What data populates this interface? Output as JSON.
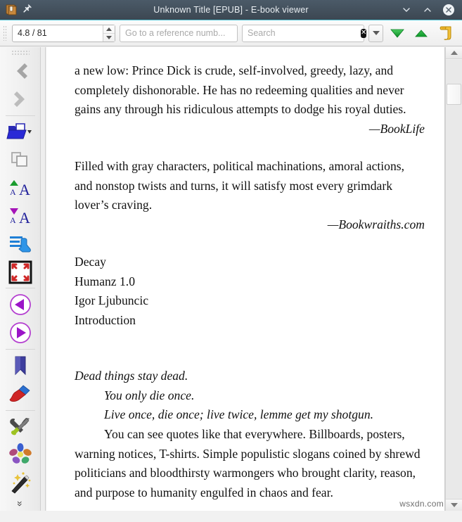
{
  "window": {
    "title": "Unknown Title [EPUB] - E-book viewer",
    "app_icon": "book-icon",
    "pin_icon": "pin-icon",
    "minimize_label": "minimize-icon",
    "maximize_label": "maximize-icon",
    "close_label": "close-icon"
  },
  "toolbar": {
    "position_value": "4.8 / 81",
    "reference_placeholder": "Go to a reference numb...",
    "reference_value": "",
    "search_placeholder": "Search",
    "search_value": "",
    "clear_glyph": "✕",
    "next_match_icon": "green-down-triangle-icon",
    "prev_match_icon": "green-up-triangle-icon",
    "bookmark_icon": "yellow-scroll-icon"
  },
  "sidebar": {
    "items": [
      {
        "name": "back",
        "icon": "chevron-left-icon",
        "enabled": false
      },
      {
        "name": "forward",
        "icon": "chevron-right-icon",
        "enabled": false
      },
      {
        "name": "open-book",
        "icon": "open-folder-icon",
        "enabled": true
      },
      {
        "name": "copy",
        "icon": "copy-icon",
        "enabled": false
      },
      {
        "name": "increase-font",
        "icon": "font-larger-icon",
        "enabled": true
      },
      {
        "name": "decrease-font",
        "icon": "font-smaller-icon",
        "enabled": true
      },
      {
        "name": "table-of-contents",
        "icon": "toc-hand-icon",
        "enabled": true
      },
      {
        "name": "fullscreen",
        "icon": "fullscreen-arrows-icon",
        "enabled": true
      },
      {
        "name": "previous-page",
        "icon": "purple-back-circle-icon",
        "enabled": true
      },
      {
        "name": "next-page",
        "icon": "purple-forward-circle-icon",
        "enabled": true
      },
      {
        "name": "bookmark",
        "icon": "blue-bookmark-icon",
        "enabled": true
      },
      {
        "name": "highlight",
        "icon": "paintbrush-icon",
        "enabled": true
      },
      {
        "name": "preferences",
        "icon": "tools-icon",
        "enabled": true
      },
      {
        "name": "inspector",
        "icon": "flower-icon",
        "enabled": true
      },
      {
        "name": "magic",
        "icon": "magic-wand-icon",
        "enabled": true
      }
    ],
    "overflow_glyph": "»"
  },
  "document": {
    "blocks": [
      {
        "kind": "paragraph",
        "text": "a new low: Prince Dick is crude, self-involved, greedy, lazy, and completely dishonorable. He has no redeeming qualities and never gains any through his ridiculous attempts to dodge his royal duties."
      },
      {
        "kind": "attribution",
        "text": "—BookLife"
      },
      {
        "kind": "spacer"
      },
      {
        "kind": "paragraph",
        "text": "Filled with gray characters, political machinations, amoral actions, and nonstop twists and turns, it will satisfy most every grimdark lover’s craving."
      },
      {
        "kind": "attribution",
        "text": "—Bookwraiths.com"
      },
      {
        "kind": "spacer"
      },
      {
        "kind": "line",
        "text": "Decay"
      },
      {
        "kind": "line",
        "text": "Humanz 1.0"
      },
      {
        "kind": "line",
        "text": "Igor Ljubuncic"
      },
      {
        "kind": "line",
        "text": "Introduction"
      },
      {
        "kind": "spacer"
      },
      {
        "kind": "spacer"
      },
      {
        "kind": "italic-line",
        "text": "Dead things stay dead."
      },
      {
        "kind": "italic-indent",
        "text": "You only die once."
      },
      {
        "kind": "italic-indent",
        "text": "Live once, die once; live twice, lemme get my shotgun."
      },
      {
        "kind": "indent",
        "text": "You can see quotes like that everywhere. Billboards, posters, warning notices, T-shirts. Simple populistic slogans coined by shrewd politicians and bloodthirsty warmongers who brought clarity, reason, and purpose to humanity engulfed in chaos and fear."
      }
    ]
  },
  "scrollbar": {
    "up_icon": "scroll-up-arrow-icon",
    "down_icon": "scroll-down-arrow-icon"
  },
  "watermark": {
    "text": "wsxdn.com"
  },
  "colors": {
    "titlebar": "#42505c",
    "accent_cyan": "#5bc8d8",
    "green": "#17a83c",
    "purple": "#9b14c8",
    "blue": "#2222bb",
    "red": "#cc2222",
    "yellow": "#e8b020"
  }
}
